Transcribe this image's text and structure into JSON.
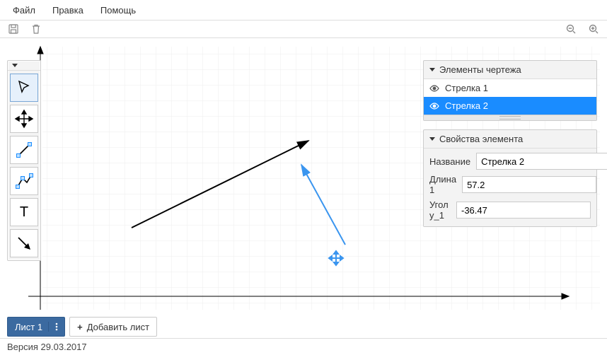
{
  "menu": {
    "file": "Файл",
    "edit": "Правка",
    "help": "Помощь"
  },
  "panels": {
    "elements_title": "Элементы чертежа",
    "properties_title": "Свойства элемента",
    "layers": [
      {
        "name": "Стрелка 1",
        "selected": false
      },
      {
        "name": "Стрелка 2",
        "selected": true
      }
    ],
    "props": {
      "name_label": "Название",
      "name_value": "Стрелка 2",
      "length_label": "Длина 1",
      "length_value": "57.2",
      "angle_label": "Угол y_1",
      "angle_value": "-36.47"
    }
  },
  "tabs": {
    "active": "Лист 1",
    "add": "Добавить лист"
  },
  "status": {
    "version": "Версия 29.03.2017"
  }
}
